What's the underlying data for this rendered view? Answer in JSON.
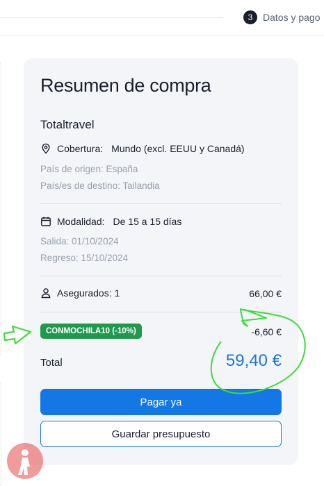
{
  "stepper": {
    "number": "3",
    "label": "Datos y pago"
  },
  "summary": {
    "title": "Resumen de compra",
    "product": "Totaltravel",
    "coverage_label": "Cobertura:",
    "coverage_value": "Mundo (excl. EEUU y Canadá)",
    "origin": "País de origen: España",
    "destination": "País/es de destino: Tailandia",
    "mode_label": "Modalidad:",
    "mode_value": "De 15 a 15 días",
    "departure": "Salida: 01/10/2024",
    "return": "Regreso: 15/10/2024",
    "insured_label": "Asegurados: 1",
    "insured_amount": "66,00 €",
    "coupon_code": "CONMOCHILA10 (-10%)",
    "discount_amount": "-6,60 €",
    "total_label": "Total",
    "total_value": "59,40 €",
    "pay_button": "Pagar ya",
    "save_button": "Guardar presupuesto"
  },
  "icons": {
    "coverage": "location-pin-icon",
    "mode": "calendar-icon",
    "insured": "user-icon"
  },
  "colors": {
    "accent": "#1477e6",
    "total": "#1a78d8",
    "coupon_bg": "#1f9a4d",
    "annotation": "#3ddc3a",
    "card_bg": "#f3f5f8"
  }
}
